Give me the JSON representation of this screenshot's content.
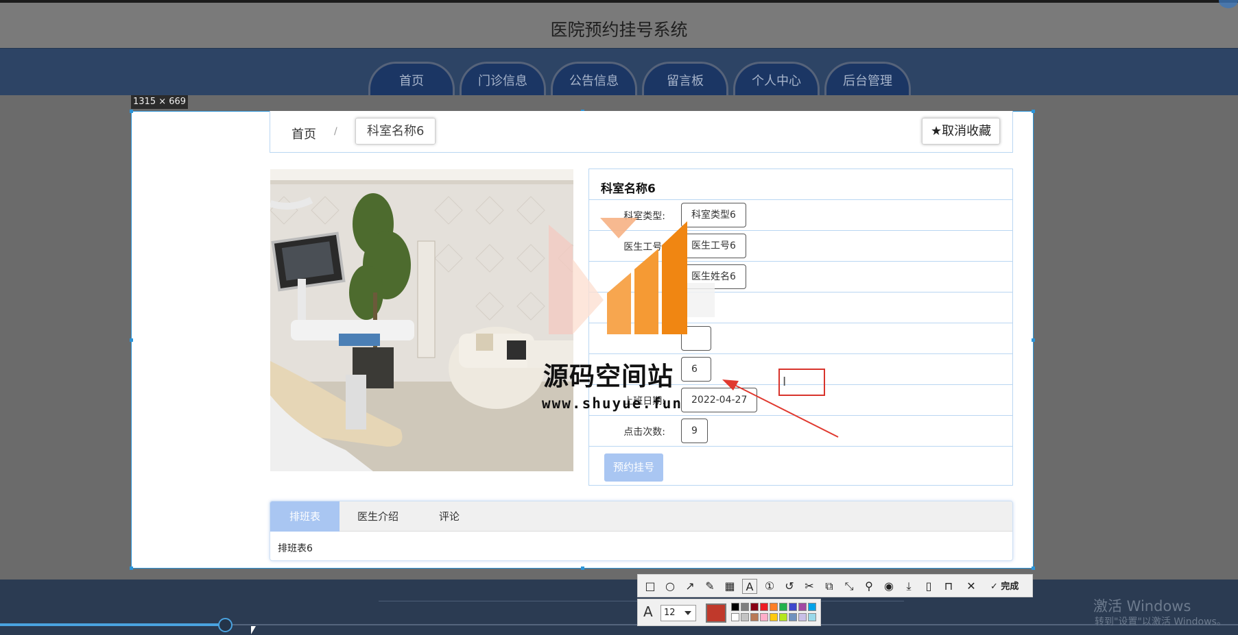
{
  "site": {
    "title": "医院预约挂号系统"
  },
  "nav": {
    "tabs": [
      {
        "label": "首页"
      },
      {
        "label": "门诊信息"
      },
      {
        "label": "公告信息"
      },
      {
        "label": "留言板"
      },
      {
        "label": "个人中心"
      },
      {
        "label": "后台管理"
      }
    ]
  },
  "capture": {
    "size_label": "1315 × 669"
  },
  "breadcrumb": {
    "home": "首页",
    "separator": "/",
    "current": "科室名称6"
  },
  "unfavorite_button": {
    "icon": "star-icon",
    "label": "★取消收藏"
  },
  "detail": {
    "title": "科室名称6",
    "rows": [
      {
        "label": "科室类型:",
        "value": "科室类型6"
      },
      {
        "label": "医生工号:",
        "value": "医生工号6"
      },
      {
        "label": "",
        "value": "医生姓名6"
      },
      {
        "label": "",
        "value": ""
      },
      {
        "label": "",
        "value": ""
      },
      {
        "label": "",
        "value": "6"
      },
      {
        "label": "上班日期:",
        "value": "2022-04-27"
      },
      {
        "label": "点击次数:",
        "value": "9"
      }
    ],
    "book_button": "预约挂号"
  },
  "tabs_panel": {
    "tabs": [
      {
        "label": "排班表",
        "active": true
      },
      {
        "label": "医生介绍",
        "active": false
      },
      {
        "label": "评论",
        "active": false
      }
    ],
    "content": "排班表6"
  },
  "watermark": {
    "text": "源码空间站",
    "url": "www.shuyue.fun"
  },
  "screenshot_tool": {
    "done_label": "完成",
    "font_size": "12",
    "current_color": "#c0392b",
    "palette_top": [
      "#000000",
      "#7f7f7f",
      "#880015",
      "#ed1c24",
      "#ff7f27",
      "#22b14c",
      "#3f48cc",
      "#a349a4",
      "#00a2e8"
    ],
    "palette_bottom": [
      "#ffffff",
      "#c3c3c3",
      "#b97a57",
      "#ffaec9",
      "#ffc90e",
      "#b5e61d",
      "#7092be",
      "#c8bfe7",
      "#99d9ea"
    ]
  },
  "os_notice": {
    "line1": "激活 Windows",
    "line2": "转到\"设置\"以激活 Windows。"
  },
  "colors": {
    "nav_bg": "#2d4465",
    "tab_active": "#a9c6f2",
    "selection_border": "#2b94d8",
    "annotation_red": "#d8332b"
  }
}
